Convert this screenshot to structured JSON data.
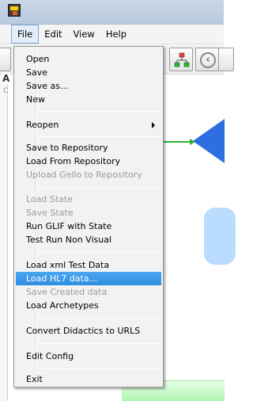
{
  "menubar": {
    "items": [
      "File",
      "Edit",
      "View",
      "Help"
    ],
    "active": "File"
  },
  "canvas": {
    "fragment_title": "A",
    "fragment_sub": "C"
  },
  "file_menu": {
    "items": [
      {
        "label": "Open",
        "enabled": true
      },
      {
        "label": "Save",
        "enabled": true
      },
      {
        "label": "Save as...",
        "enabled": true
      },
      {
        "label": "New",
        "enabled": true
      },
      {
        "label": "Reopen",
        "enabled": true,
        "submenu": true
      },
      {
        "label": "Save to Repository",
        "enabled": true
      },
      {
        "label": "Load From Repository",
        "enabled": true
      },
      {
        "label": "Upload Gello to Repository",
        "enabled": false
      },
      {
        "label": "Load State",
        "enabled": false
      },
      {
        "label": "Save State",
        "enabled": false
      },
      {
        "label": "Run GLIF with State",
        "enabled": true
      },
      {
        "label": "Test Run Non Visual",
        "enabled": true
      },
      {
        "label": "Load xml Test Data",
        "enabled": true
      },
      {
        "label": "Load HL7 data...",
        "enabled": true,
        "highlighted": true
      },
      {
        "label": "Save Created data",
        "enabled": false
      },
      {
        "label": "Load Archetypes",
        "enabled": true
      },
      {
        "label": "Convert Didactics to URLS",
        "enabled": true
      },
      {
        "label": "Edit Config",
        "enabled": true
      },
      {
        "label": "Exit",
        "enabled": true
      }
    ]
  },
  "colors": {
    "highlight": "#3399ff",
    "connector": "#2ab52a",
    "diamond": "#2d6fe0",
    "rounded_box": "#b9dcff"
  },
  "icons": [
    "app-icon",
    "tree-icon",
    "back-arrow-icon",
    "submenu-arrow-icon"
  ]
}
